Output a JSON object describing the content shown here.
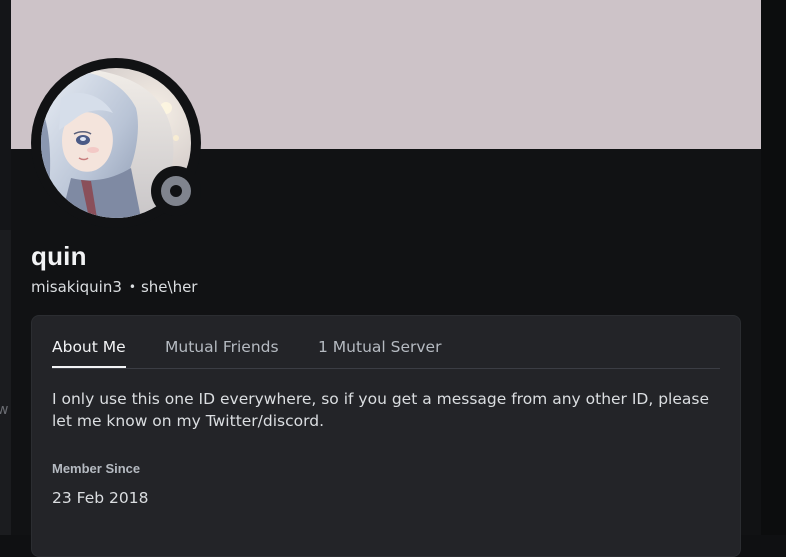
{
  "profile": {
    "display_name": "quin",
    "username": "misakiquin3",
    "separator": "•",
    "pronouns": "she\\her",
    "status": "offline",
    "banner_color": "#cdc3c8",
    "avatar": "anime-girl-avatar"
  },
  "tabs": [
    {
      "label": "About Me",
      "active": true
    },
    {
      "label": "Mutual Friends",
      "active": false
    },
    {
      "label": "1 Mutual Server",
      "active": false
    }
  ],
  "about": {
    "bio": "I only use this one ID everywhere, so if you get a message from any other ID, please let me know on my Twitter/discord.",
    "member_since_label": "Member Since",
    "member_since_value": "23 Feb 2018"
  },
  "background": {
    "left_edge_glyph": "w"
  }
}
